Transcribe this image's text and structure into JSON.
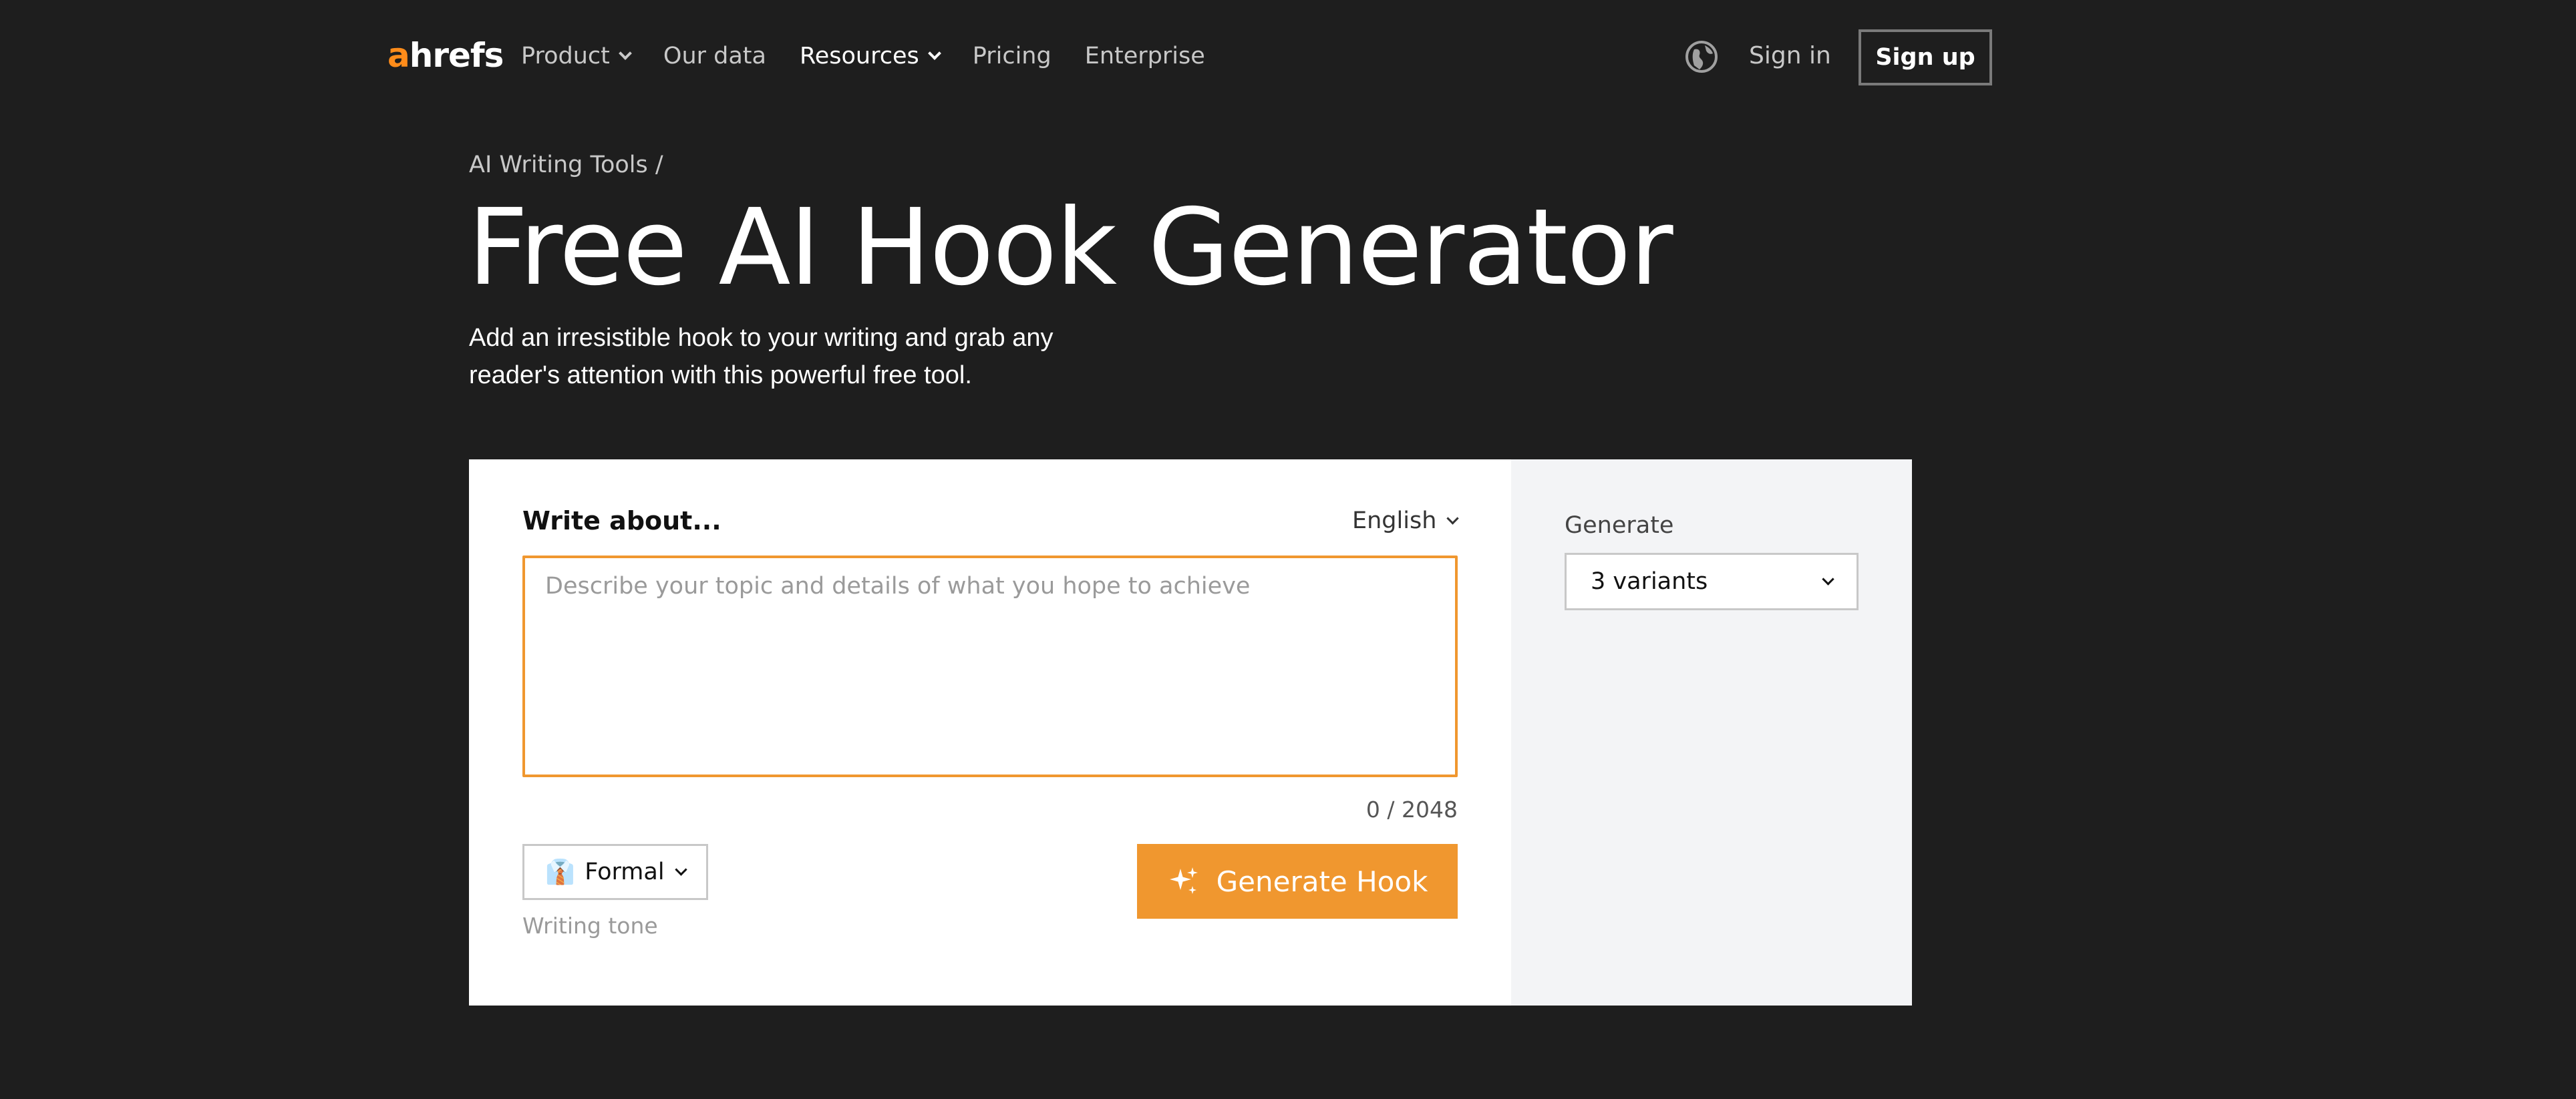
{
  "nav": {
    "logo_a": "a",
    "logo_rest": "hrefs",
    "links": [
      {
        "label": "Product",
        "dropdown": true
      },
      {
        "label": "Our data",
        "dropdown": false
      },
      {
        "label": "Resources",
        "dropdown": true
      },
      {
        "label": "Pricing",
        "dropdown": false
      },
      {
        "label": "Enterprise",
        "dropdown": false
      }
    ],
    "globe_icon": "globe-icon",
    "sign_in": "Sign in",
    "sign_up": "Sign up"
  },
  "hero": {
    "breadcrumb": "AI Writing Tools /",
    "title": "Free AI Hook Generator",
    "subtitle": "Add an irresistible hook to your writing and grab any reader's attention with this powerful free tool."
  },
  "tool": {
    "write_label": "Write about...",
    "language": "English",
    "textarea_placeholder": "Describe your topic and details of what you hope to achieve",
    "textarea_value": "",
    "counter": "0 / 2048",
    "tone_value": "Formal",
    "tone_icon": "👔",
    "tone_label": "Writing tone",
    "generate_button": "Generate Hook",
    "generate_label": "Generate",
    "variants_value": "3 variants"
  },
  "colors": {
    "background": "#1e1e1e",
    "accent": "#f0972f",
    "logo_accent": "#ff8c1a"
  }
}
